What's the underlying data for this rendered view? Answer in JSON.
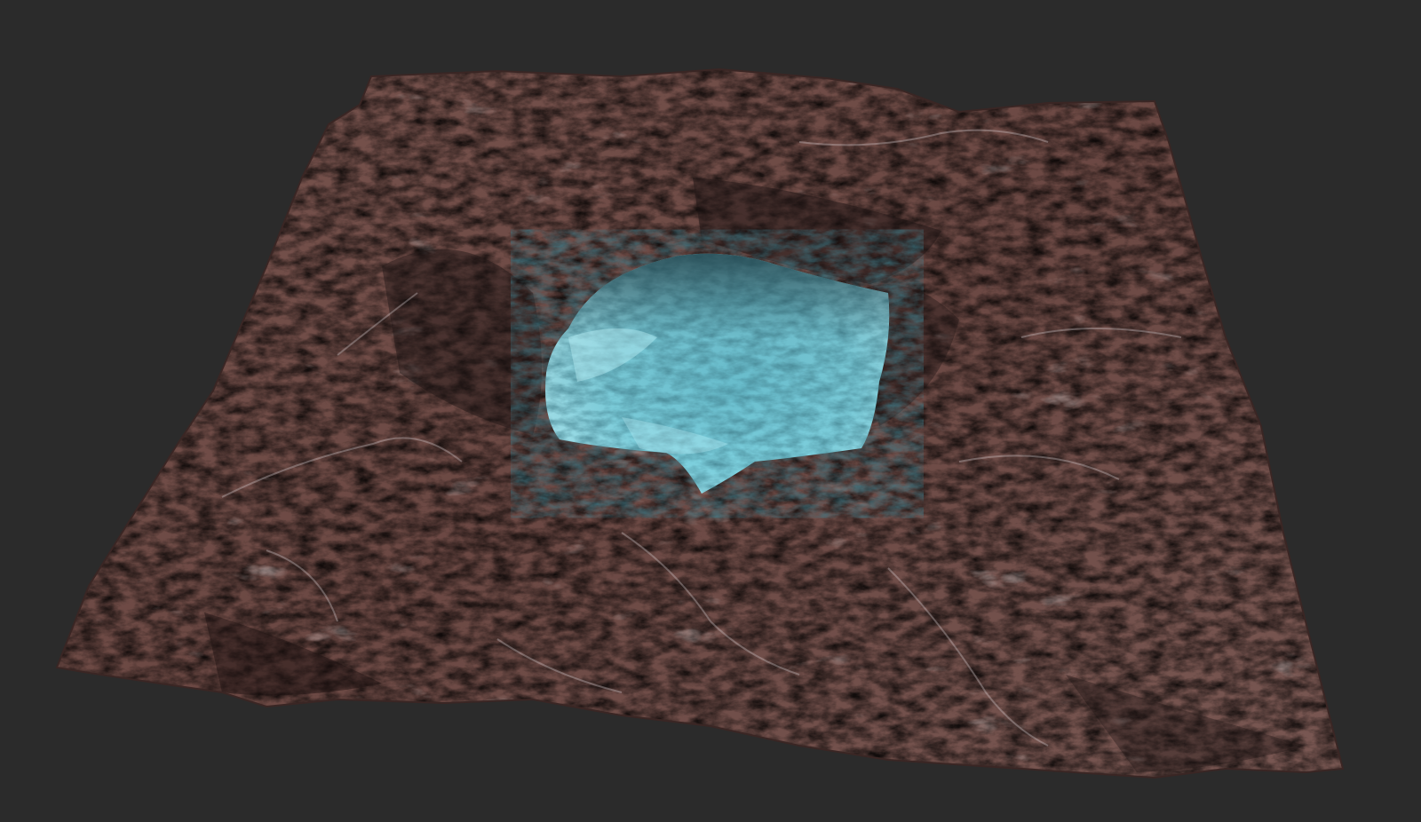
{
  "scene": {
    "subject": "terrain-render",
    "background_color": "#2b2b2b",
    "terrain": {
      "rock_color": "#6e4a44",
      "rock_dark_color": "#2a1c1c",
      "rock_light_color": "#a07a72",
      "erosion_highlight_color": "#d8cfd0"
    },
    "crater_lake": {
      "surface_color": "#7fd2e0",
      "shadow_color": "#2f6e7c",
      "highlight_color": "#b9eef5"
    }
  }
}
